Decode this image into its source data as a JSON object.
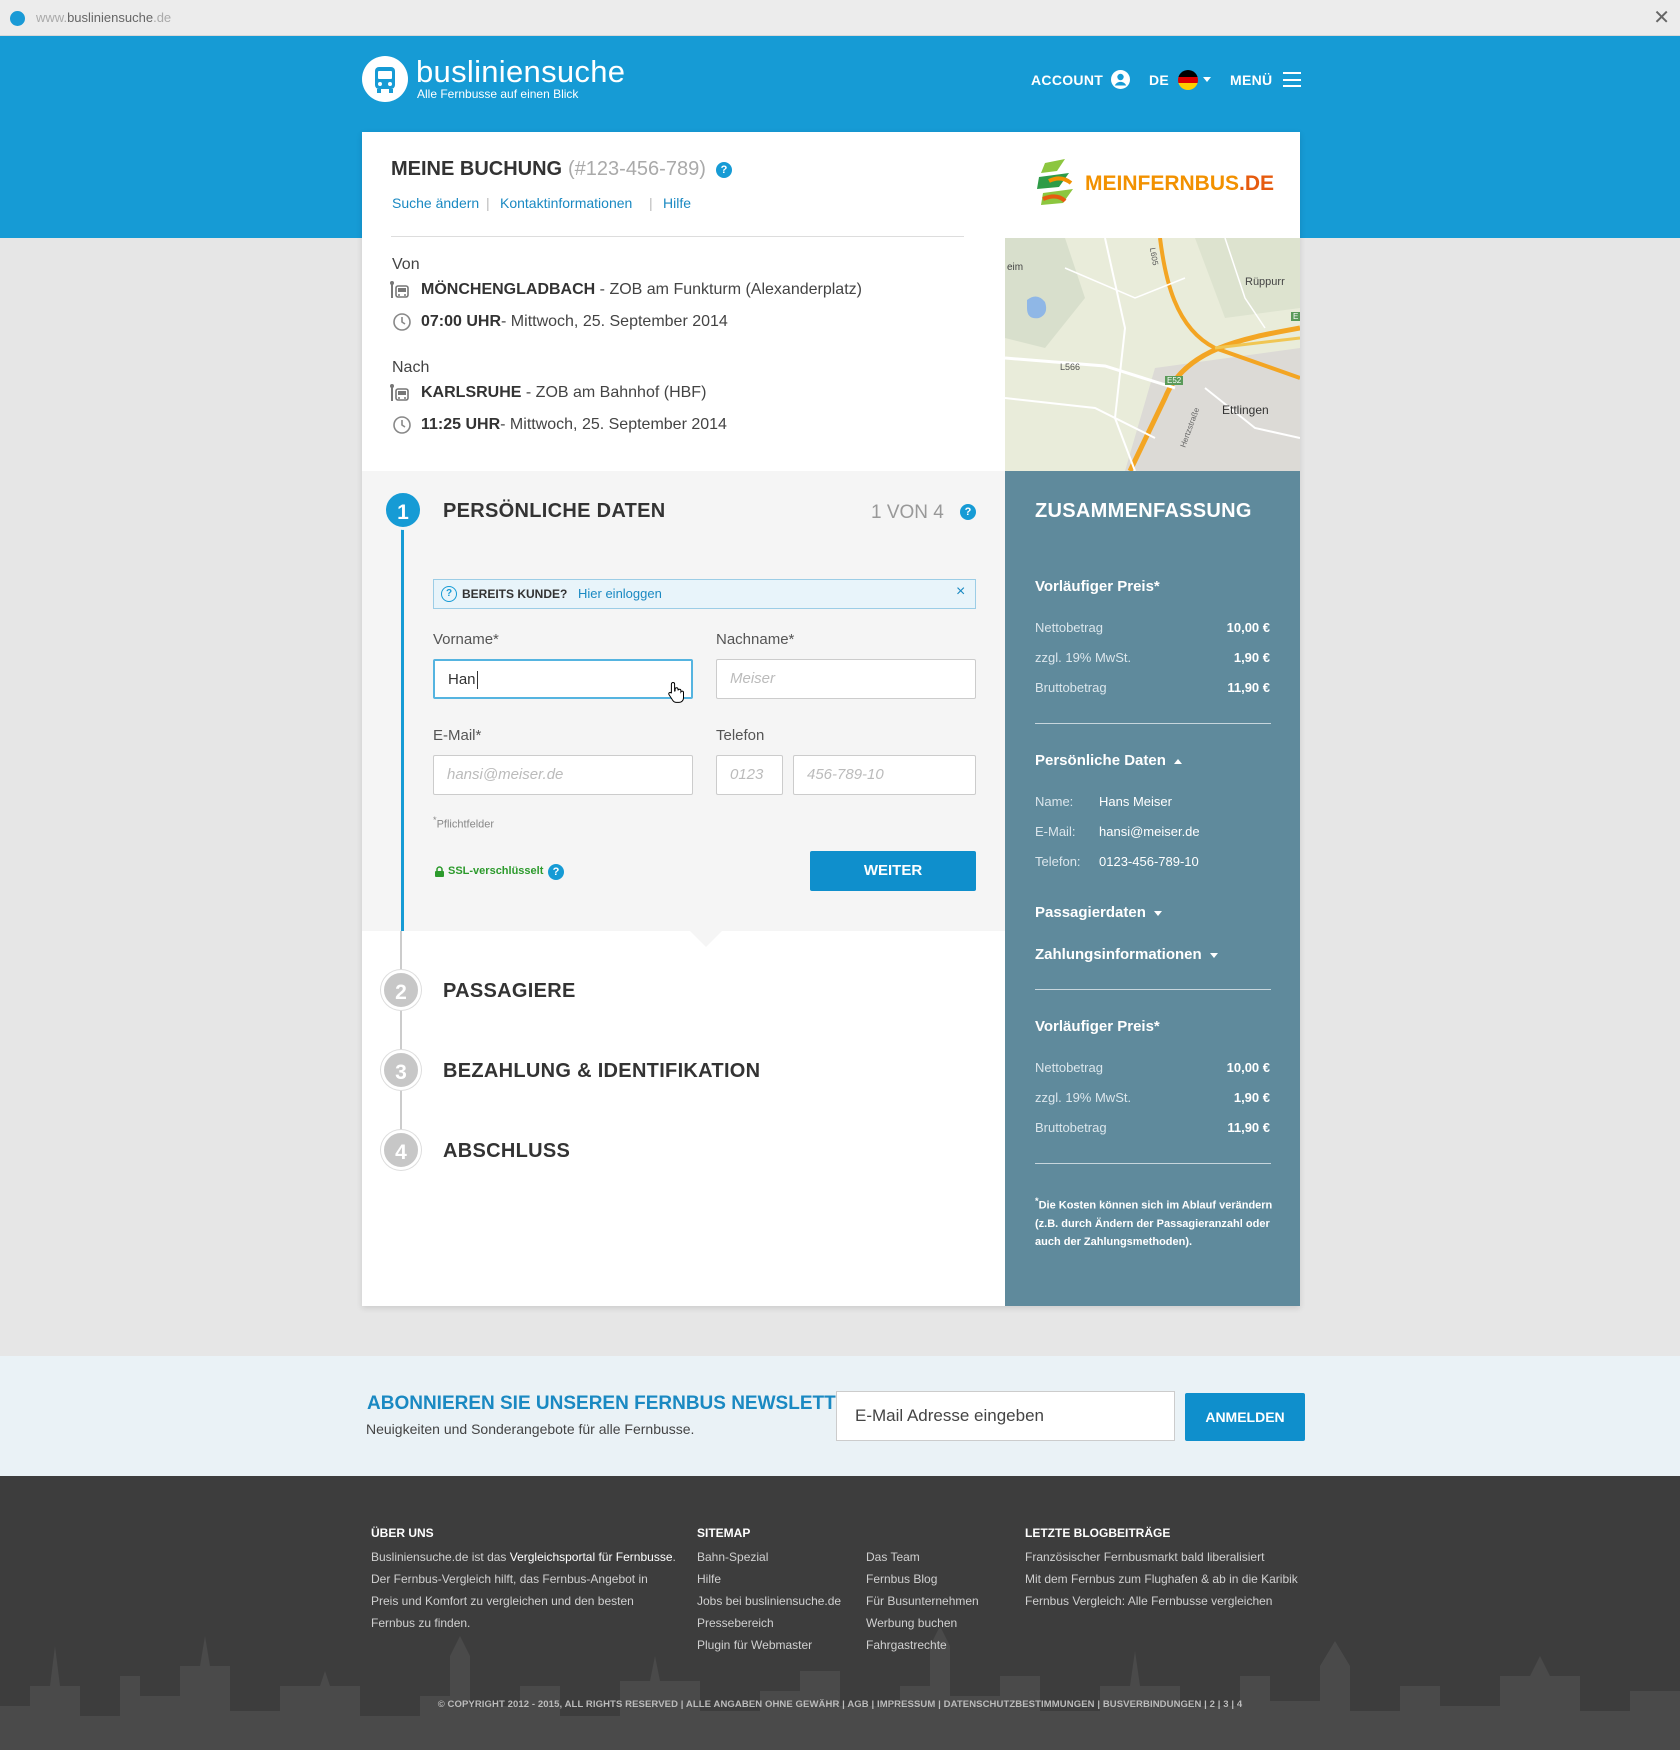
{
  "browser": {
    "url_prefix": "www.",
    "url_domain": "busliniensuche",
    "url_suffix": ".de",
    "close": "✕"
  },
  "header": {
    "brand": "busliniensuche",
    "tagline": "Alle Fernbusse auf einen Blick",
    "account_label": "ACCOUNT",
    "language": "DE",
    "menu_label": "MENÜ"
  },
  "booking": {
    "title": "MEINE BUCHUNG",
    "number": "(#123-456-789)",
    "help_icon": "?",
    "links": [
      "Suche ändern",
      "Kontaktinformationen",
      "Hilfe"
    ],
    "separator": "|",
    "partner_main": "MEINFERNBUS",
    "partner_tld": ".DE"
  },
  "route": {
    "from_label": "Von",
    "from_city": "MÖNCHENGLADBACH",
    "from_stop": " - ZOB am Funkturm (Alexanderplatz)",
    "from_time": "07:00 UHR",
    "from_date": "- Mittwoch, 25. September 2014",
    "to_label": "Nach",
    "to_city": "KARLSRUHE",
    "to_stop": " - ZOB am Bahnhof (HBF)",
    "to_time": "11:25 UHR",
    "to_date": "- Mittwoch, 25. September 2014"
  },
  "map": {
    "labels": [
      "eim",
      "Rüppurr",
      "L566",
      "E52",
      "Ettlingen",
      "Hertzstraße",
      "L605",
      "E"
    ]
  },
  "steps": [
    {
      "num": "1",
      "title": "PERSÖNLICHE DATEN"
    },
    {
      "num": "2",
      "title": "PASSAGIERE"
    },
    {
      "num": "3",
      "title": "BEZAHLUNG & IDENTIFIKATION"
    },
    {
      "num": "4",
      "title": "ABSCHLUSS"
    }
  ],
  "step_count": "1 VON 4",
  "notice": {
    "icon": "?",
    "label": "BEREITS KUNDE?",
    "link": "Hier einloggen",
    "close": "×"
  },
  "form": {
    "firstname_label": "Vorname*",
    "firstname_value": "Han",
    "lastname_label": "Nachname*",
    "lastname_placeholder": "Meiser",
    "email_label": "E-Mail*",
    "email_placeholder": "hansi@meiser.de",
    "phone_label": "Telefon",
    "phone_prefix_placeholder": "0123",
    "phone_number_placeholder": "456-789-10",
    "required_star": "*",
    "required_note": "Pflichtfelder",
    "ssl_label": "SSL-verschlüsselt",
    "submit": "WEITER"
  },
  "summary": {
    "title": "ZUSAMMENFASSUNG",
    "price_heading": "Vorläufiger Preis*",
    "net_label": "Nettobetrag",
    "net_value": "10,00 €",
    "vat_label": "zzgl. 19% MwSt.",
    "vat_value": "1,90 €",
    "gross_label": "Bruttobetrag",
    "gross_value": "11,90 €",
    "personal_heading": "Persönliche Daten",
    "name_label": "Name:",
    "name_value": "Hans Meiser",
    "email_label": "E-Mail:",
    "email_value": "hansi@meiser.de",
    "phone_label": "Telefon:",
    "phone_value": "0123-456-789-10",
    "passenger_heading": "Passagierdaten",
    "payment_heading": "Zahlungsinformationen",
    "footnote_star": "*",
    "footnote": "Die Kosten können sich im Ablauf verändern (z.B. durch Ändern der Passagieranzahl oder auch der Zahlungsmethoden)."
  },
  "newsletter": {
    "title": "ABONNIEREN SIE UNSEREN FERNBUS NEWSLETTER",
    "subtitle": "Neuigkeiten und Sonderangebote für alle Fernbusse.",
    "input_placeholder": "E-Mail Adresse eingeben",
    "button": "ANMELDEN"
  },
  "footer": {
    "about_heading": "ÜBER UNS",
    "about_text_1": "Busliniensuche.de ist das ",
    "about_text_bold": "Vergleichsportal für Fernbusse",
    "about_text_2": ". Der Fernbus-Vergleich hilft, das Fernbus-Angebot in Preis und Komfort zu vergleichen und den besten Fernbus zu finden.",
    "sitemap_heading": "SITEMAP",
    "sitemap_col1": [
      "Bahn-Spezial",
      "Hilfe",
      "Jobs bei busliniensuche.de",
      "Pressebereich",
      "Plugin für Webmaster"
    ],
    "sitemap_col2": [
      "Das Team",
      "Fernbus Blog",
      "Für Busunternehmen",
      "Werbung buchen",
      "Fahrgastrechte"
    ],
    "blog_heading": "LETZTE BLOGBEITRÄGE",
    "blog_posts": [
      "Französischer Fernbusmarkt bald liberalisiert",
      "Mit dem Fernbus zum Flughafen & ab in die Karibik",
      "Fernbus Vergleich: Alle Fernbusse vergleichen"
    ],
    "copyright": "© COPYRIGHT 2012 - 2015, ALL RIGHTS RESERVED | ALLE ANGABEN OHNE GEWÄHR | AGB | IMPRESSUM | DATENSCHUTZBESTIMMUNGEN | BUSVERBINDUNGEN | 2 | 3 | 4"
  }
}
